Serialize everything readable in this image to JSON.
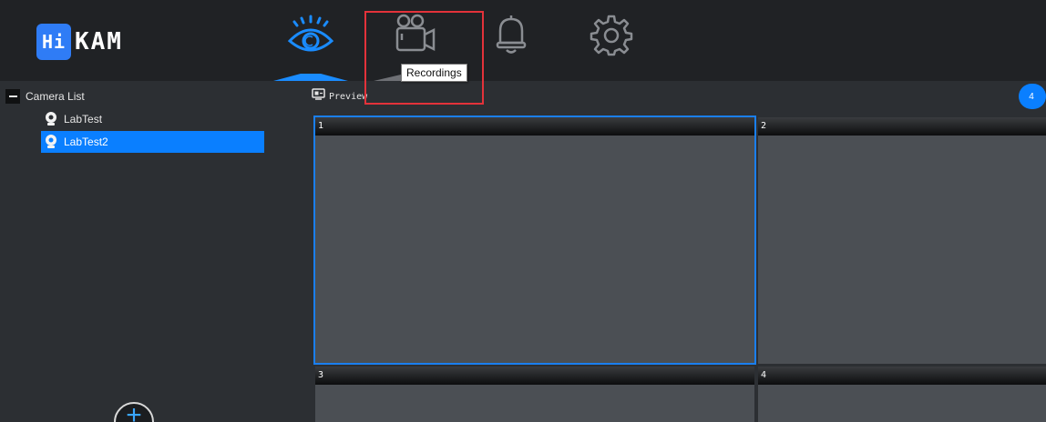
{
  "logo": {
    "badge": "Hi",
    "text": "KAM"
  },
  "nav": {
    "items": [
      {
        "name": "live-view",
        "icon": "eye-icon"
      },
      {
        "name": "recordings",
        "icon": "video-camera-icon"
      },
      {
        "name": "alarms",
        "icon": "bell-icon"
      },
      {
        "name": "settings",
        "icon": "gear-icon"
      }
    ],
    "active": "live-view",
    "tooltip": "Recordings"
  },
  "sidebar": {
    "title": "Camera List",
    "cameras": [
      {
        "label": "LabTest",
        "selected": false
      },
      {
        "label": "LabTest2",
        "selected": true
      }
    ]
  },
  "preview": {
    "label": "Preview",
    "count": "4",
    "cells": [
      "1",
      "2",
      "3",
      "4"
    ],
    "active_cell": "1"
  },
  "colors": {
    "accent": "#0a7fff",
    "highlight": "#e3323a",
    "topbar": "#202225",
    "background": "#2c2f33",
    "cell": "#4b4f54"
  }
}
